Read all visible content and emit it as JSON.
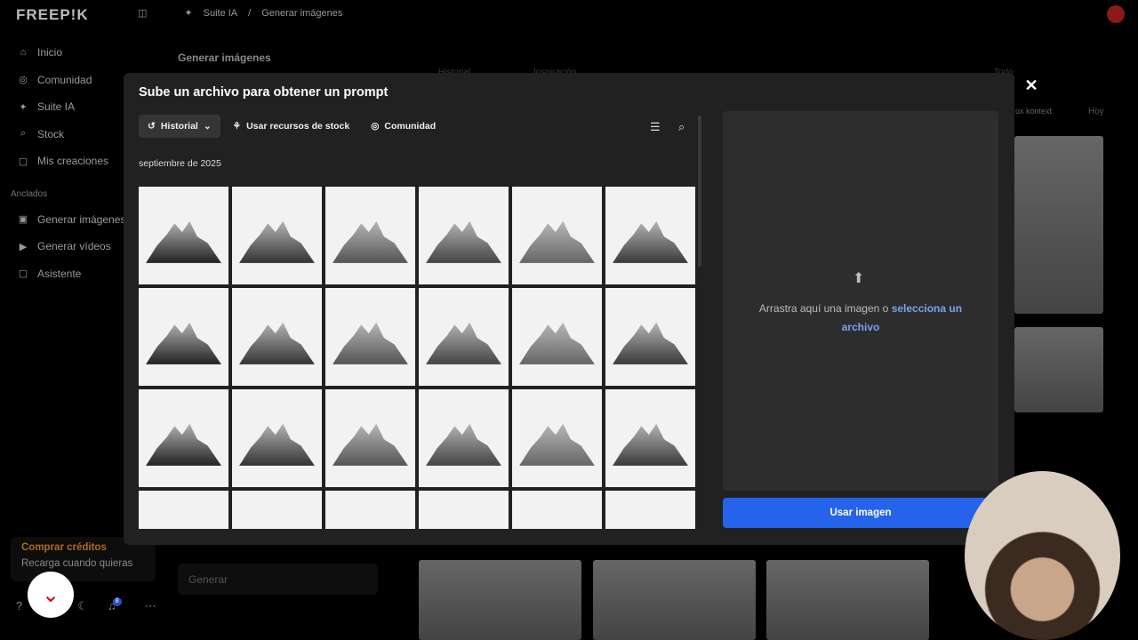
{
  "app": {
    "logo": "FREEP!K",
    "breadcrumb": [
      "Suite IA",
      "Generar imágenes"
    ]
  },
  "sidebar": {
    "items": [
      {
        "icon": "home-icon",
        "glyph": "⌂",
        "label": "Inicio"
      },
      {
        "icon": "globe-icon",
        "glyph": "◎",
        "label": "Comunidad"
      },
      {
        "icon": "sparkle-icon",
        "glyph": "✦",
        "label": "Suite IA"
      },
      {
        "icon": "search-icon",
        "glyph": "⌕",
        "label": "Stock"
      },
      {
        "icon": "creations-icon",
        "glyph": "▢",
        "label": "Mis creaciones"
      }
    ],
    "pinned_label": "Anclados",
    "pinned": [
      {
        "icon": "image-icon",
        "glyph": "▣",
        "label": "Generar imágenes"
      },
      {
        "icon": "video-icon",
        "glyph": "▶",
        "label": "Generar vídeos"
      },
      {
        "icon": "assistant-icon",
        "glyph": "▢",
        "label": "Asistente"
      }
    ],
    "credits": {
      "title": "Comprar créditos",
      "subtitle": "Recarga cuando quieras"
    },
    "notifications": "8"
  },
  "background": {
    "title": "Generar imágenes",
    "generate_placeholder": "Generar",
    "tabs": [
      "Historial",
      "Inspiración",
      "Todo"
    ],
    "filter": "ux kontext",
    "today": "Hoy"
  },
  "modal": {
    "title": "Sube un archivo para obtener un prompt",
    "tabs": [
      {
        "label": "Historial"
      },
      {
        "label": "Usar recursos de stock"
      },
      {
        "label": "Comunidad"
      }
    ],
    "date_group": "septiembre de 2025",
    "drop_text": "Arrastra aquí una imagen o ",
    "drop_link": "selecciona un archivo",
    "use_button": "Usar imagen",
    "thumbnail_count": 24
  }
}
